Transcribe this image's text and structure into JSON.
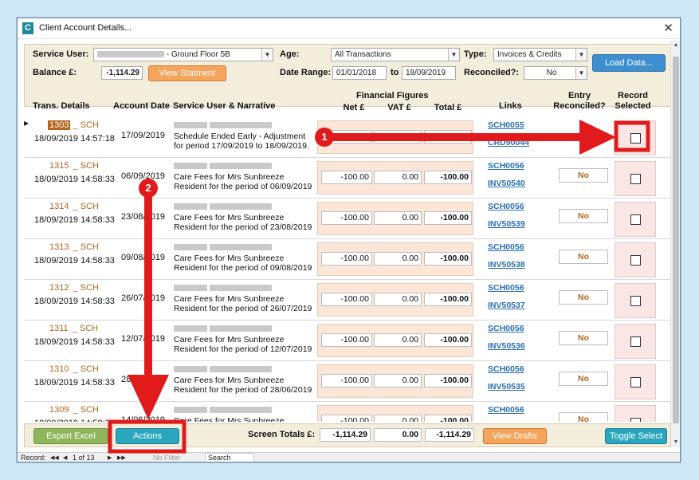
{
  "window": {
    "title": "Client Account Details...",
    "close_glyph": "✕",
    "icon_letter": "C"
  },
  "filters": {
    "service_user_label": "Service User:",
    "service_user_value": "- Ground Floor 5B",
    "age_label": "Age:",
    "age_value": "All Transactions",
    "type_label": "Type:",
    "type_value": "Invoices & Credits",
    "load_button": "Load Data...",
    "balance_label": "Balance £:",
    "balance_value": "-1,114.29",
    "view_statement_button": "View Statment",
    "date_range_label": "Date Range:",
    "date_from": "01/01/2018",
    "date_to_label": "to",
    "date_to": "18/09/2019",
    "reconciled_label": "Reconciled?:",
    "reconciled_value": "No"
  },
  "columns": {
    "trans_details": "Trans. Details",
    "account_date": "Account Date",
    "service_user_narrative": "Service User & Narrative",
    "financial_figures": "Financial Figures",
    "net": "Net £",
    "vat": "VAT £",
    "total": "Total £",
    "links": "Links",
    "entry_reconciled": "Entry Reconciled?",
    "record_selected": "Record Selected"
  },
  "rows": [
    {
      "num": "1303",
      "code": "SCH",
      "timestamp": "18/09/2019 14:57:18",
      "account_date": "17/09/2019",
      "narrative_1": "Schedule Ended Early - Adjustment",
      "narrative_2": "for period 17/09/2019 to 18/09/2019.",
      "net": "",
      "vat": "",
      "total": "",
      "link1": "SCH0055",
      "link2": "CRD90044",
      "reconciled": "",
      "selected": true
    },
    {
      "num": "1315",
      "code": "SCH",
      "timestamp": "18/09/2019 14:58:33",
      "account_date": "06/09/2019",
      "narrative_1": "Care Fees for Mrs Sunbreeze",
      "narrative_2": "Resident for the period of 06/09/2019",
      "net": "-100.00",
      "vat": "0.00",
      "total": "-100.00",
      "link1": "SCH0056",
      "link2": "INV50540",
      "reconciled": "No",
      "selected": false
    },
    {
      "num": "1314",
      "code": "SCH",
      "timestamp": "18/09/2019 14:58:33",
      "account_date": "23/08/2019",
      "narrative_1": "Care Fees for Mrs Sunbreeze",
      "narrative_2": "Resident for the period of 23/08/2019",
      "net": "-100.00",
      "vat": "0.00",
      "total": "-100.00",
      "link1": "SCH0056",
      "link2": "INV50539",
      "reconciled": "No",
      "selected": false
    },
    {
      "num": "1313",
      "code": "SCH",
      "timestamp": "18/09/2019 14:58:33",
      "account_date": "09/08/2019",
      "narrative_1": "Care Fees for Mrs Sunbreeze",
      "narrative_2": "Resident for the period of 09/08/2019",
      "net": "-100.00",
      "vat": "0.00",
      "total": "-100.00",
      "link1": "SCH0056",
      "link2": "INV50538",
      "reconciled": "No",
      "selected": false
    },
    {
      "num": "1312",
      "code": "SCH",
      "timestamp": "18/09/2019 14:58:33",
      "account_date": "26/07/2019",
      "narrative_1": "Care Fees for Mrs Sunbreeze",
      "narrative_2": "Resident for the period of 26/07/2019",
      "net": "-100.00",
      "vat": "0.00",
      "total": "-100.00",
      "link1": "SCH0056",
      "link2": "INV50537",
      "reconciled": "No",
      "selected": false
    },
    {
      "num": "1311",
      "code": "SCH",
      "timestamp": "18/09/2019 14:58:33",
      "account_date": "12/07/2019",
      "narrative_1": "Care Fees for Mrs Sunbreeze",
      "narrative_2": "Resident for the period of 12/07/2019",
      "net": "-100.00",
      "vat": "0.00",
      "total": "-100.00",
      "link1": "SCH0056",
      "link2": "INV50536",
      "reconciled": "No",
      "selected": false
    },
    {
      "num": "1310",
      "code": "SCH",
      "timestamp": "18/09/2019 14:58:33",
      "account_date": "28/06/2019",
      "narrative_1": "Care Fees for Mrs Sunbreeze",
      "narrative_2": "Resident for the period of 28/06/2019",
      "net": "-100.00",
      "vat": "0.00",
      "total": "-100.00",
      "link1": "SCH0056",
      "link2": "INV50535",
      "reconciled": "No",
      "selected": false
    },
    {
      "num": "1309",
      "code": "SCH",
      "timestamp": "18/09/2019 14:58:33",
      "account_date": "14/06/2019",
      "narrative_1": "Care Fees for Mrs Sunbreeze",
      "narrative_2": "",
      "net": "-100.00",
      "vat": "0.00",
      "total": "-100.00",
      "link1": "SCH0056",
      "link2": "",
      "reconciled": "No",
      "selected": false
    }
  ],
  "footer": {
    "export_button": "Export Excel",
    "actions_button": "Actions",
    "screen_totals_label": "Screen Totals £:",
    "total_net": "-1,114.29",
    "total_vat": "0.00",
    "total_total": "-1,114.29",
    "view_drafts_button": "View Drafts",
    "toggle_select_button": "Toggle Select"
  },
  "statusbar": {
    "record_label": "Record:",
    "first_glyph": "◀◀",
    "prev_glyph": "◀",
    "position": "1 of 13",
    "next_glyph": "▶",
    "last_glyph": "▶▶",
    "filter": "No Filter",
    "search": "Search"
  },
  "annotations": {
    "badge_1": "1",
    "badge_2": "2",
    "highlight_color": "#e11b1b"
  }
}
